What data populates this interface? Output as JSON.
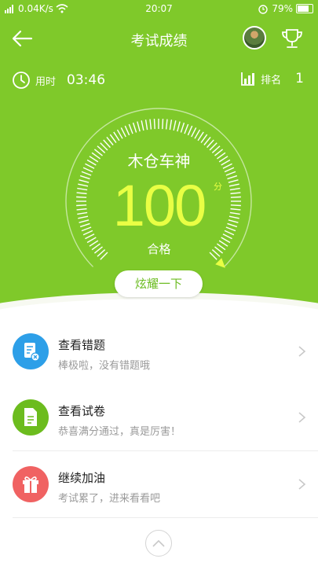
{
  "status_bar": {
    "network_speed": "0.04K/s",
    "time": "20:07",
    "battery": "79%"
  },
  "header": {
    "title": "考试成绩"
  },
  "stats": {
    "time_label": "用时",
    "time_value": "03:46",
    "rank_label": "排名",
    "rank_value": "1"
  },
  "result": {
    "nickname": "木仓车神",
    "score": "100",
    "unit": "分",
    "status": "合格",
    "score_fraction": 1.0,
    "show_button": "炫耀一下"
  },
  "menu": [
    {
      "title": "查看错题",
      "subtitle": "棒极啦，没有错题哦",
      "icon": "wrong-questions-icon",
      "color": "#2d9fe8"
    },
    {
      "title": "查看试卷",
      "subtitle": "恭喜满分通过，真是厉害！",
      "icon": "exam-paper-icon",
      "color": "#6cbc1e"
    },
    {
      "title": "继续加油",
      "subtitle": "考试累了，进来看看吧",
      "icon": "gift-icon",
      "color": "#f06262"
    }
  ],
  "colors": {
    "header_green": "#7fc92a",
    "score_yellow": "#e9ff44",
    "accent_green": "#6cbc22"
  }
}
